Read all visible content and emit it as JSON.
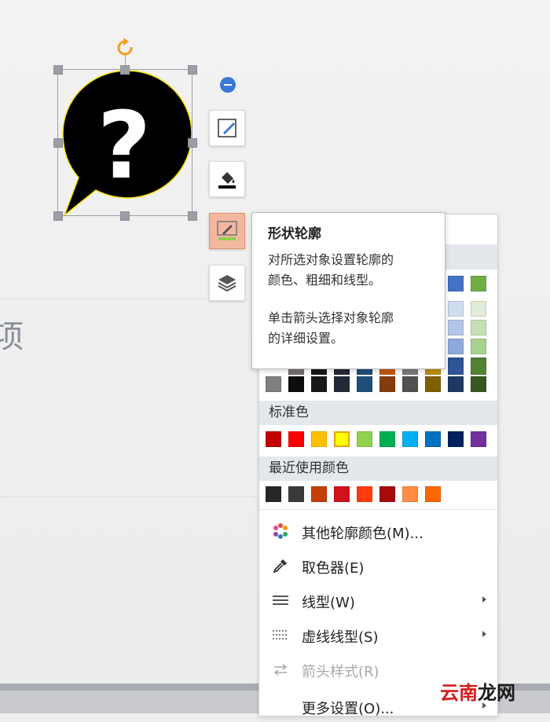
{
  "slide": {
    "cut_char": "项",
    "shape_glyph": "?"
  },
  "tooltip": {
    "title": "形状轮廓",
    "line1": "对所选对象设置轮廓的",
    "line2": "颜色、粗细和线型。",
    "line3": "单击箭头选择对象轮廓",
    "line4": "的详细设置。"
  },
  "menu": {
    "standard_label": "标准色",
    "recent_label": "最近使用颜色",
    "theme_row1": [
      "#4472c4",
      "#70ad47"
    ],
    "theme_tints": [
      [
        "#d0dcf0",
        "#e1ecd8"
      ],
      [
        "#b4c6e7",
        "#c5e0b4"
      ],
      [
        "#8eaadb",
        "#a9d18e"
      ],
      [
        "#2f5597",
        "#538135"
      ]
    ],
    "theme_dark": [
      "#7f7f7f",
      "#0d0d0d",
      "#171717",
      "#222a35",
      "#1f4e79",
      "#843c0c",
      "#525252",
      "#7f6000",
      "#1f3864",
      "#385723"
    ],
    "theme_partial": [
      "#767171",
      "#171717",
      "#222a35",
      "#1f4e79",
      "#c55a11",
      "#7b7b7b",
      "#bf9000",
      "#2f5597",
      "#548235"
    ],
    "standard_colors": [
      "#c00000",
      "#ff0000",
      "#ffc000",
      "#ffff00",
      "#92d050",
      "#00b050",
      "#00b0f0",
      "#0070c0",
      "#002060",
      "#7030a0"
    ],
    "recent_colors": [
      "#262626",
      "#3a3a3a",
      "#c43e07",
      "#d0121b",
      "#ff3b0f",
      "#a50b0b",
      "#ff8c42",
      "#ff6600"
    ],
    "items": [
      {
        "label": "其他轮廓颜色(M)...",
        "icon": "palette-icon"
      },
      {
        "label": "取色器(E)",
        "icon": "eyedropper-icon"
      },
      {
        "label": "线型(W)",
        "icon": "line-weight-icon"
      },
      {
        "label": "虚线线型(S)",
        "icon": "dash-type-icon"
      },
      {
        "label": "箭头样式(R)",
        "icon": "arrow-style-icon"
      },
      {
        "label": "更多设置(O)...",
        "icon": ""
      }
    ]
  },
  "watermark": {
    "part1": "云南",
    "part2": "龙网"
  },
  "colors": {
    "accent": "#3a78d8",
    "active_button": "#f3b79f",
    "rotate_handle": "#f39c1f",
    "outline": "#f5e400"
  }
}
